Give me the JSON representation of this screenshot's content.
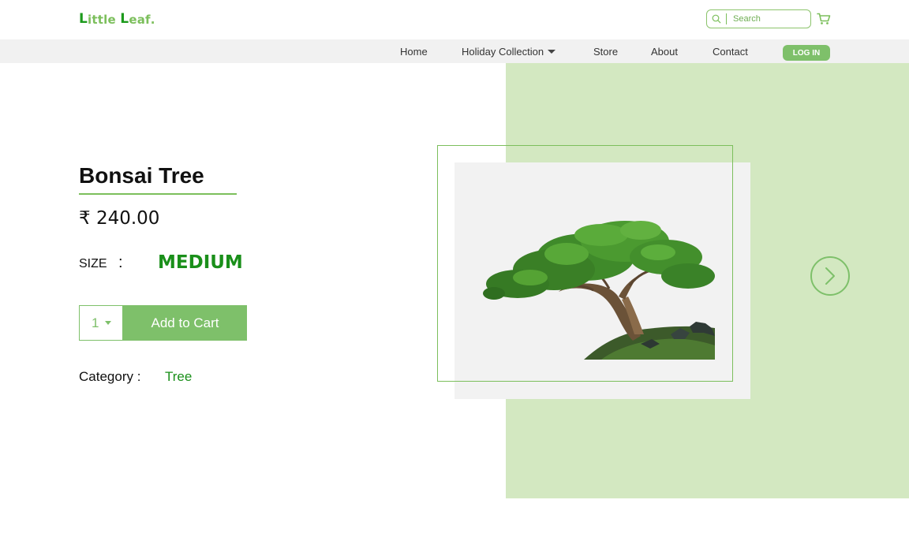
{
  "brand": {
    "first": "L",
    "first_rest": "ittle ",
    "second": "L",
    "second_rest": "eaf",
    "dot": "."
  },
  "search": {
    "placeholder": "Search"
  },
  "icons": {
    "search": "search-icon",
    "cart": "cart-icon",
    "dropdown": "caret-down-icon",
    "next": "chevron-right-icon"
  },
  "nav": {
    "home": "Home",
    "holiday": "Holiday Collection",
    "store": "Store",
    "about": "About",
    "contact": "Contact",
    "login": "LOG IN"
  },
  "product": {
    "title": "Bonsai Tree",
    "price": "₹ 240.00",
    "size_label": "SIZE",
    "size_separator": ":",
    "size_value": "MEDIUM",
    "quantity": "1",
    "add_to_cart": "Add to Cart",
    "category_label": "Category :",
    "category_value": "Tree"
  },
  "colors": {
    "accent": "#7ec06a",
    "dark_green": "#1a8f1a",
    "panel_bg": "#d3e8c1",
    "nav_bg": "#f1f1f1"
  }
}
